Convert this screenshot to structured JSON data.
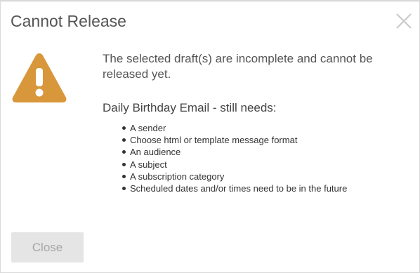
{
  "dialog": {
    "title": "Cannot Release",
    "close_icon": "close-icon",
    "warning_icon": "warning-icon",
    "warning_color": "#d8973a",
    "message": "The selected draft(s) are incomplete and cannot be released yet.",
    "needs_heading": "Daily Birthday Email - still needs:",
    "needs": [
      "A sender",
      "Choose html or template message format",
      "An audience",
      "A subject",
      "A subscription category",
      "Scheduled dates and/or times need to be in the future"
    ],
    "close_button_label": "Close"
  }
}
